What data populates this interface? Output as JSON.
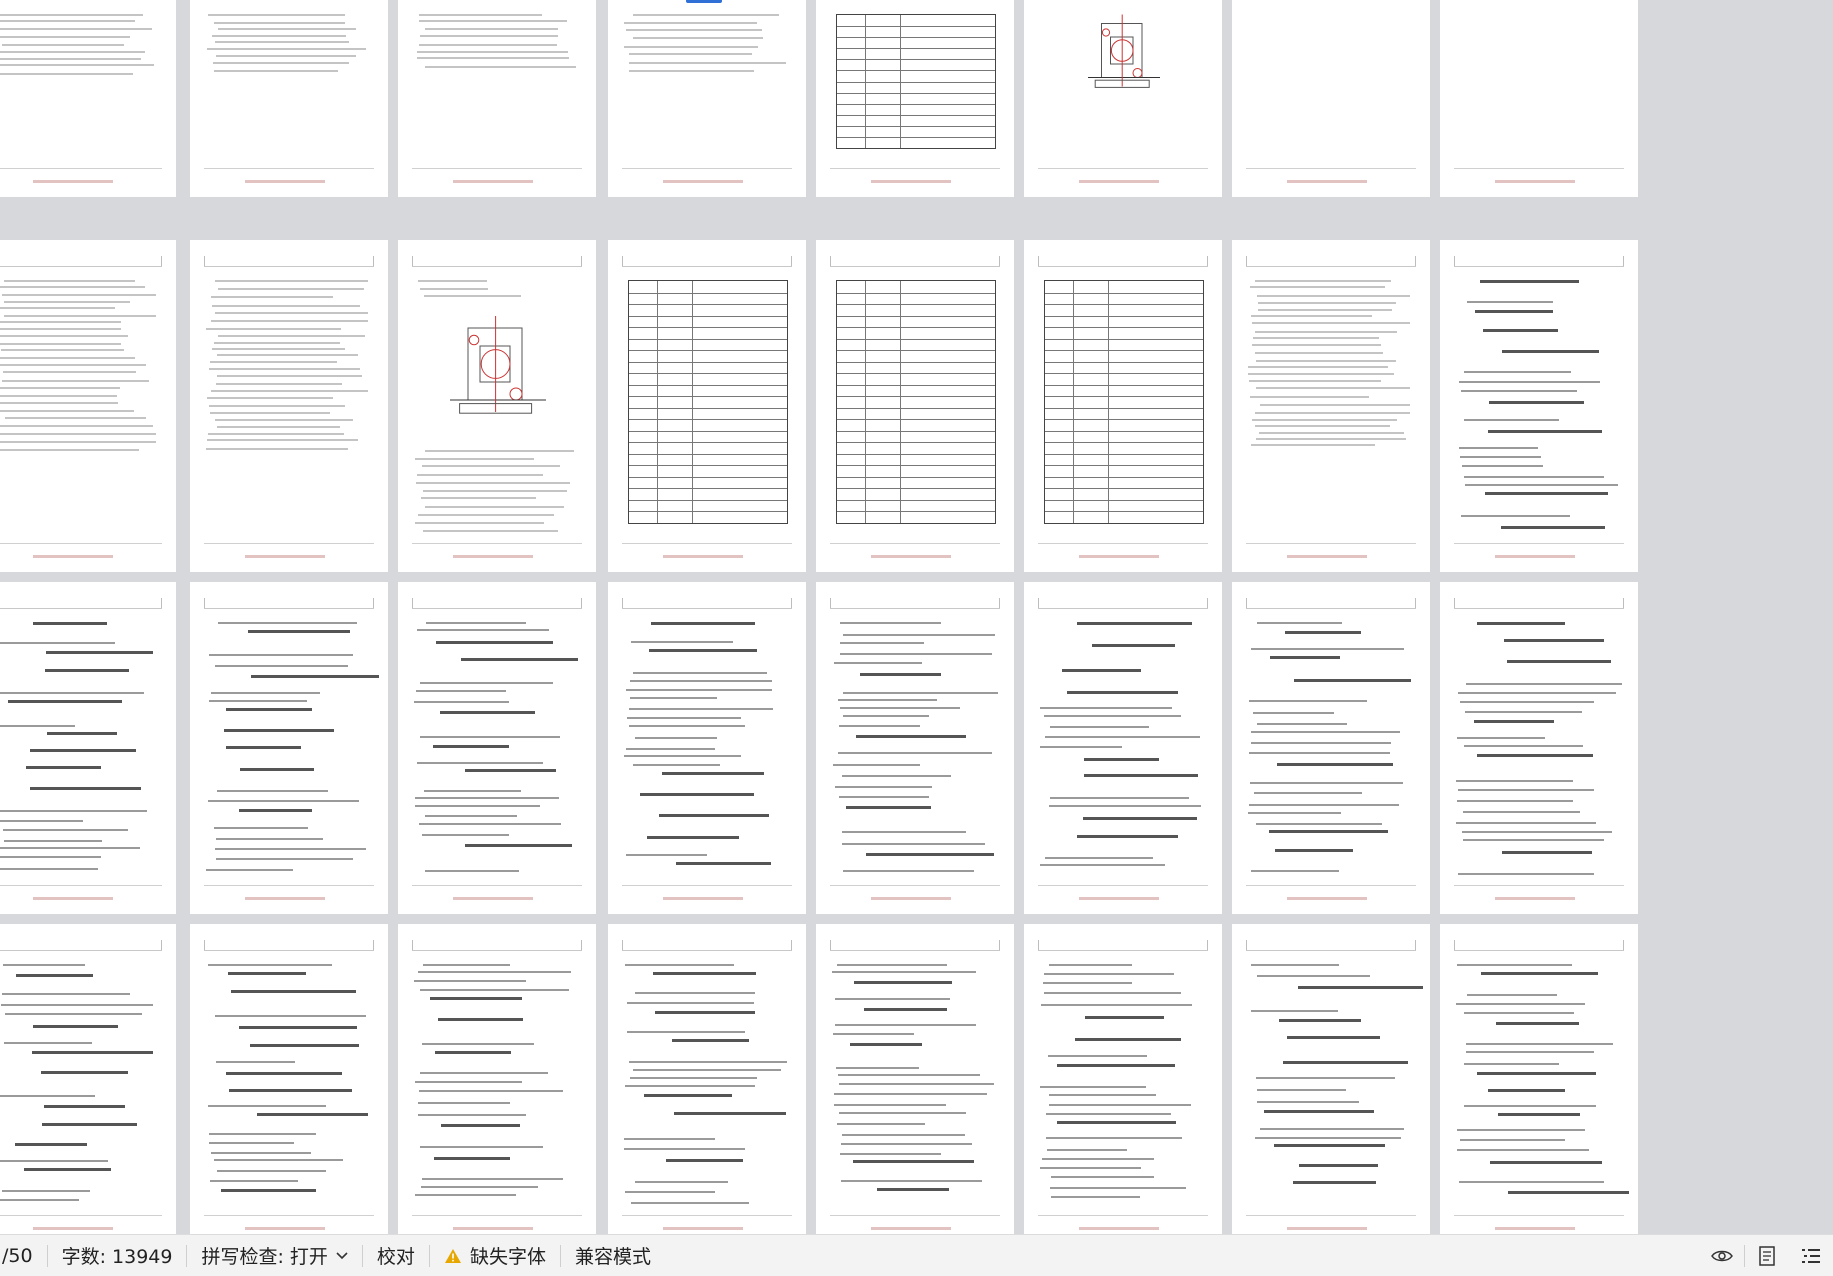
{
  "statusbar": {
    "page_count": "/50",
    "word_count": "字数: 13949",
    "spell_check": "拼写检查: 打开",
    "proofread": "校对",
    "missing_fonts": "缺失字体",
    "compat_mode": "兼容模式"
  },
  "colors": {
    "workspace_bg": "#d6d8dc",
    "page_bg": "#ffffff",
    "statusbar_bg": "#f3f3f3",
    "accent": "#2f6fd6",
    "warning": "#e6a700"
  },
  "icons": [
    "chevron-down-icon",
    "warning-icon",
    "eye-icon",
    "document-view-icon",
    "outline-list-icon"
  ],
  "thumbnails": {
    "rows": 4,
    "columns_visible": 8,
    "row_kinds": [
      [
        "text",
        "text",
        "text",
        "text",
        "table",
        "figure",
        "blank",
        "blank"
      ],
      [
        "text",
        "text",
        "figure",
        "table",
        "table",
        "table",
        "text",
        "formula"
      ],
      [
        "formula",
        "formula",
        "formula",
        "formula",
        "formula",
        "formula",
        "formula",
        "formula"
      ],
      [
        "formula",
        "formula",
        "formula",
        "formula",
        "formula",
        "formula",
        "formula",
        "formula"
      ]
    ]
  }
}
